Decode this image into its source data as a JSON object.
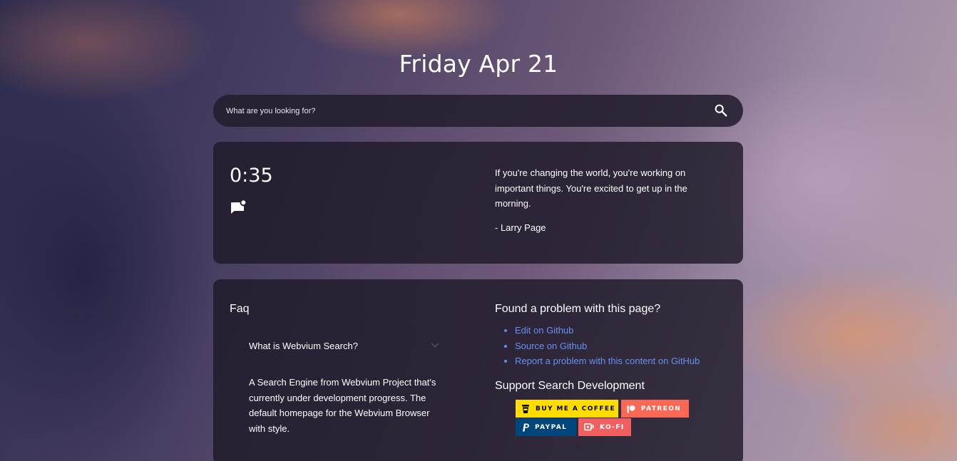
{
  "header": {
    "date": "Friday Apr 21"
  },
  "search": {
    "placeholder": "What are you looking for?",
    "icon": "search-icon"
  },
  "widget": {
    "clock": "0:35",
    "quote_icon": "message-icon",
    "quote": "If you're changing the world, you're working on important things. You're excited to get up in the morning.",
    "author": "- Larry Page"
  },
  "faq": {
    "title": "Faq",
    "question": "What is Webvium Search?",
    "answer": "A Search Engine from Webvium Project that's currently under development progress. The default homepage for the Webvium Browser with style."
  },
  "problem": {
    "title": "Found a problem with this page?",
    "links": [
      {
        "label": "Edit on Github"
      },
      {
        "label": "Source on Github"
      },
      {
        "label": "Report a problem with this content on GitHub"
      }
    ]
  },
  "support": {
    "title": "Support Search Development",
    "badges": [
      {
        "label": "BUY ME A COFFEE",
        "color": "#FFDD00"
      },
      {
        "label": "PATREON",
        "color": "#F96854"
      },
      {
        "label": "PAYPAL",
        "color": "#00457C"
      },
      {
        "label": "KO-FI",
        "color": "#F16061"
      }
    ]
  },
  "colors": {
    "link": "#6591F2",
    "card": "#1E1A28"
  }
}
